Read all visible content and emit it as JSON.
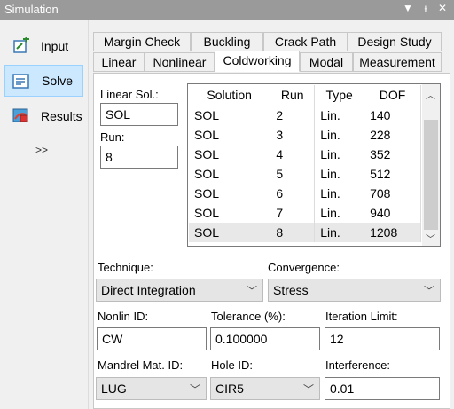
{
  "window": {
    "title": "Simulation"
  },
  "nav": [
    {
      "label": "Input",
      "icon": "input-icon"
    },
    {
      "label": "Solve",
      "icon": "solve-icon"
    },
    {
      "label": "Results",
      "icon": "results-icon"
    }
  ],
  "nav_more": ">>",
  "tabs_row1": [
    "Margin Check",
    "Buckling",
    "Crack Path",
    "Design Study"
  ],
  "tabs_row2": [
    "Linear",
    "Nonlinear",
    "Coldworking",
    "Modal",
    "Measurement"
  ],
  "form": {
    "linear_sol_label": "Linear Sol.:",
    "linear_sol_value": "SOL",
    "run_label": "Run:",
    "run_value": "8",
    "technique_label": "Technique:",
    "technique_value": "Direct Integration",
    "convergence_label": "Convergence:",
    "convergence_value": "Stress",
    "nonlin_label": "Nonlin ID:",
    "nonlin_value": "CW",
    "tolerance_label": "Tolerance (%):",
    "tolerance_value": "0.100000",
    "iter_label": "Iteration Limit:",
    "iter_value": "12",
    "mandrel_label": "Mandrel Mat. ID:",
    "mandrel_value": "LUG",
    "hole_label": "Hole ID:",
    "hole_value": "CIR5",
    "interference_label": "Interference:",
    "interference_value": "0.01"
  },
  "grid": {
    "headers": [
      "Solution",
      "Run",
      "Type",
      "DOF"
    ],
    "rows": [
      [
        "SOL",
        "2",
        "Lin.",
        "140"
      ],
      [
        "SOL",
        "3",
        "Lin.",
        "228"
      ],
      [
        "SOL",
        "4",
        "Lin.",
        "352"
      ],
      [
        "SOL",
        "5",
        "Lin.",
        "512"
      ],
      [
        "SOL",
        "6",
        "Lin.",
        "708"
      ],
      [
        "SOL",
        "7",
        "Lin.",
        "940"
      ],
      [
        "SOL",
        "8",
        "Lin.",
        "1208"
      ]
    ],
    "selected_row": 6
  }
}
